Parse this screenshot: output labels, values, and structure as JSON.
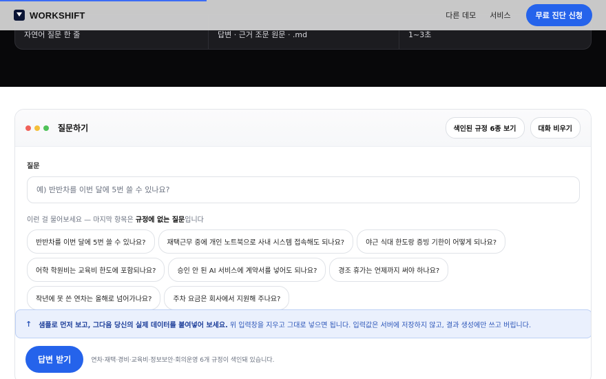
{
  "nav": {
    "brand": "WORKSHIFT",
    "links": [
      "다른 데모",
      "서비스"
    ],
    "cta": "무료 진단 신청"
  },
  "spec_row": [
    "자연어 질문 한 줄",
    "답변 · 근거 조문 원문 · .md",
    "1~3초"
  ],
  "card": {
    "title": "질문하기",
    "actions": [
      "색인된 규정 6종 보기",
      "대화 비우기"
    ],
    "question_label": "질문",
    "question_placeholder": "예) 반반차를 이번 달에 5번 쓸 수 있나요?",
    "hint_prefix": "이런 걸 물어보세요 — 마지막 항목은 ",
    "hint_bold": "규정에 없는 질문",
    "hint_suffix": "입니다",
    "chips": [
      "반반차를 이번 달에 5번 쓸 수 있나요?",
      "재택근무 중에 개인 노트북으로 사내 시스템 접속해도 되나요?",
      "야근 식대 한도랑 증빙 기한이 어떻게 되나요?",
      "어학 학원비는 교육비 한도에 포함되나요?",
      "승인 안 된 AI 서비스에 계약서를 넣어도 되나요?",
      "경조 휴가는 언제까지 써야 하나요?",
      "작년에 못 쓴 연차는 올해로 넘어가나요?",
      "주차 요금은 회사에서 지원해 주나요?"
    ],
    "notice_arrow": "↑",
    "notice_bold": "샘플로 먼저 보고, 그다음 당신의 실제 데이터를 붙여넣어 보세요.",
    "notice_text": "위 입력창을 지우고 그대로 넣으면 됩니다. 입력값은 서버에 저장하지 않고, 결과 생성에만 쓰고 버립니다.",
    "submit": "답변 받기",
    "footnote": "연차·재택·경비·교육비·정보보안·회의운영 6개 규정이 색인돼 있습니다."
  },
  "colors": {
    "accent": "#2563eb",
    "hero_bg": "#08080a",
    "notice_bg": "#eaf0fd"
  }
}
